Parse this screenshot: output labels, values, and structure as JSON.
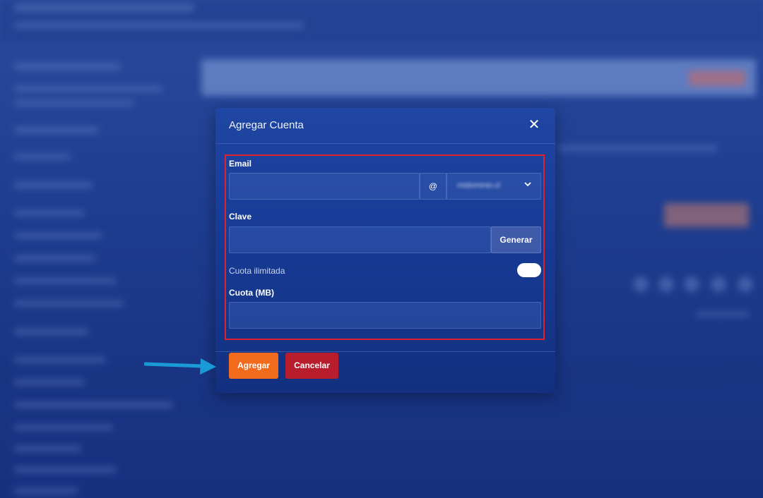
{
  "modal": {
    "title": "Agregar Cuenta",
    "close_icon": "close-icon",
    "email": {
      "label": "Email",
      "value": "",
      "at_symbol": "@",
      "domain_value": "midominio.cl",
      "chevron_icon": "chevron-down-icon"
    },
    "password": {
      "label": "Clave",
      "value": "",
      "generate_label": "Generar"
    },
    "unlimited_quota": {
      "label": "Cuota ilimitada",
      "enabled": false
    },
    "quota": {
      "label": "Cuota (MB)",
      "value": ""
    },
    "footer": {
      "add_label": "Agregar",
      "cancel_label": "Cancelar"
    }
  },
  "annotations": {
    "highlight_color": "#e0202e",
    "arrow_color": "#1a9ad6"
  },
  "colors": {
    "add_button": "#f26a1b",
    "cancel_button": "#b81d2e"
  }
}
